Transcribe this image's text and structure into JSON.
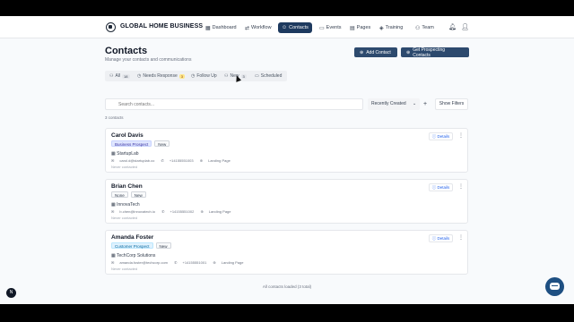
{
  "nav": {
    "brand": "GLOBAL HOME BUSINESS",
    "items": [
      {
        "label": "Dashboard",
        "icon": "▦"
      },
      {
        "label": "Workflow",
        "icon": "⇄"
      },
      {
        "label": "Contacts",
        "icon": "☺"
      },
      {
        "label": "Events",
        "icon": "▭"
      },
      {
        "label": "Pages",
        "icon": "▤"
      },
      {
        "label": "Training",
        "icon": "◈"
      },
      {
        "label": "Team",
        "icon": "⚇"
      }
    ],
    "bell_icon": "bell-icon",
    "user_icon": "user-icon"
  },
  "header": {
    "title": "Contacts",
    "subtitle": "Manage your contacts and communications",
    "add_contact": "Add Contact",
    "get_prospecting": "Get Prospecting Contacts"
  },
  "tabs": [
    {
      "label": "All",
      "count": "18"
    },
    {
      "label": "Needs Response",
      "count": "3"
    },
    {
      "label": "Follow Up",
      "count": ""
    },
    {
      "label": "New",
      "count": "3"
    },
    {
      "label": "Scheduled",
      "count": ""
    }
  ],
  "search": {
    "placeholder": "Search contacts..."
  },
  "sort": {
    "selected": "Recently Created"
  },
  "show_filters": "Show Filters",
  "count_text": "3 contacts",
  "contacts": [
    {
      "name": "Carol Davis",
      "tags": [
        "Business Prospect",
        "New"
      ],
      "company": "StartupLab",
      "email": "carol.d@startuplab.co",
      "phone": "+14155551003",
      "source": "Landing Page",
      "last": "Never contacted"
    },
    {
      "name": "Brian Chen",
      "tags": [
        "None",
        "New"
      ],
      "company": "InnovaTech",
      "email": "b.chen@innovatech.io",
      "phone": "+14155551002",
      "source": "Landing Page",
      "last": "Never contacted"
    },
    {
      "name": "Amanda Foster",
      "tags": [
        "Customer Prospect",
        "New"
      ],
      "company": "TechCorp Solutions",
      "email": "amanda.foster@techcorp.com",
      "phone": "+14155551001",
      "source": "Landing Page",
      "last": "Never contacted"
    }
  ],
  "details_label": "Details",
  "loaded_text": "All contacts loaded (3 total)",
  "fab_letter": "N"
}
